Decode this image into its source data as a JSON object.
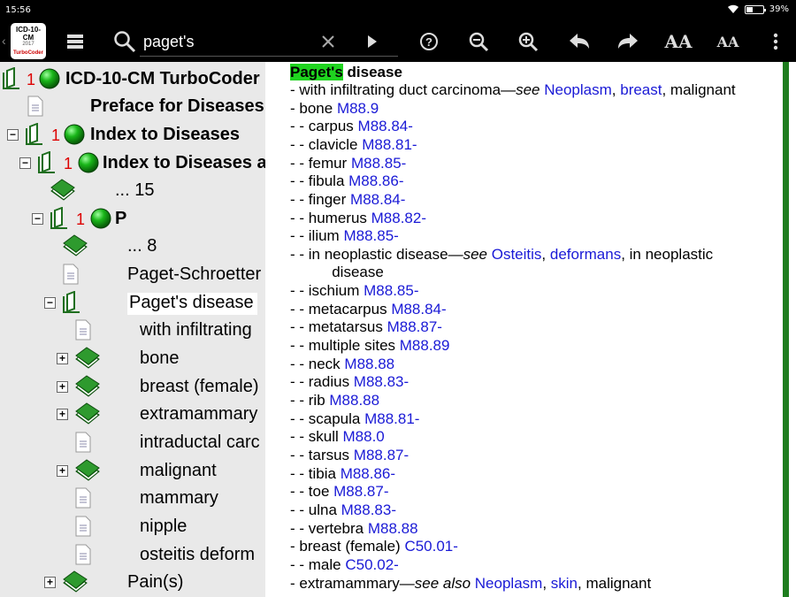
{
  "status": {
    "time": "15:56",
    "battery": "39%"
  },
  "toolbar": {
    "app_logo": {
      "line1": "ICD-10-CM",
      "line2": "2017",
      "line3": "TurboCoder"
    },
    "search_value": "paget's",
    "icons": [
      "menu-icon",
      "search-icon",
      "clear-icon",
      "go-icon",
      "help-icon",
      "zoom-out-icon",
      "zoom-in-icon",
      "back-icon",
      "forward-icon",
      "font-increase-icon",
      "font-decrease-icon",
      "overflow-icon"
    ],
    "font_increase_label": "AA",
    "font_decrease_label": "AA"
  },
  "tree": [
    {
      "label": "ICD-10-CM TurboCoder",
      "num": "1",
      "bold": true
    },
    {
      "label": "Preface for Diseases",
      "bold": true
    },
    {
      "label": "Index to Diseases",
      "num": "1",
      "bold": true,
      "toggle": "−"
    },
    {
      "label": "Index to Diseases a",
      "num": "1",
      "bold": true,
      "toggle": "−"
    },
    {
      "label": "... 15"
    },
    {
      "label": "P",
      "num": "1",
      "bold": true,
      "toggle": "−"
    },
    {
      "label": "... 8"
    },
    {
      "label": "Paget-Schroetter"
    },
    {
      "label": "Paget's disease",
      "toggle": "−",
      "selected": true
    },
    {
      "label": "with infiltrating"
    },
    {
      "label": "bone",
      "toggle": "+"
    },
    {
      "label": "breast (female)",
      "toggle": "+"
    },
    {
      "label": "extramammary",
      "toggle": "+"
    },
    {
      "label": "intraductal carc"
    },
    {
      "label": "malignant",
      "toggle": "+"
    },
    {
      "label": "mammary"
    },
    {
      "label": "nipple"
    },
    {
      "label": "osteitis deform"
    },
    {
      "label": "Pain(s)",
      "toggle": "+"
    }
  ],
  "entry": {
    "term": "Paget's",
    "term_rest": " disease",
    "lines": [
      {
        "prefix": "- with infiltrating duct carcinoma",
        "see": "see",
        "links": [
          "Neoplasm",
          "breast"
        ],
        "suffix": ", malignant"
      },
      {
        "prefix": "- bone ",
        "code": "M88.9"
      },
      {
        "prefix": "- - carpus ",
        "code": "M88.84-"
      },
      {
        "prefix": "- - clavicle ",
        "code": "M88.81-"
      },
      {
        "prefix": "- - femur ",
        "code": "M88.85-"
      },
      {
        "prefix": "- - fibula ",
        "code": "M88.86-"
      },
      {
        "prefix": "- - finger ",
        "code": "M88.84-"
      },
      {
        "prefix": "- - humerus ",
        "code": "M88.82-"
      },
      {
        "prefix": "- - ilium ",
        "code": "M88.85-"
      },
      {
        "prefix": "- - in neoplastic disease",
        "see": "see",
        "links": [
          "Osteitis",
          "deformans"
        ],
        "suffix": ", in neoplastic"
      },
      {
        "prefix": "          disease"
      },
      {
        "prefix": "- - ischium ",
        "code": "M88.85-"
      },
      {
        "prefix": "- - metacarpus ",
        "code": "M88.84-"
      },
      {
        "prefix": "- - metatarsus ",
        "code": "M88.87-"
      },
      {
        "prefix": "- - multiple sites ",
        "code": "M88.89"
      },
      {
        "prefix": "- - neck ",
        "code": "M88.88"
      },
      {
        "prefix": "- - radius ",
        "code": "M88.83-"
      },
      {
        "prefix": "- - rib ",
        "code": "M88.88"
      },
      {
        "prefix": "- - scapula ",
        "code": "M88.81-"
      },
      {
        "prefix": "- - skull ",
        "code": "M88.0"
      },
      {
        "prefix": "- - tarsus ",
        "code": "M88.87-"
      },
      {
        "prefix": "- - tibia ",
        "code": "M88.86-"
      },
      {
        "prefix": "- - toe ",
        "code": "M88.87-"
      },
      {
        "prefix": "- - ulna ",
        "code": "M88.83-"
      },
      {
        "prefix": "- - vertebra ",
        "code": "M88.88"
      },
      {
        "prefix": "- breast (female) ",
        "code": "C50.01-"
      },
      {
        "prefix": "- - male ",
        "code": "C50.02-"
      },
      {
        "prefix": "- extramammary",
        "see": "see also",
        "links": [
          "Neoplasm",
          "skin"
        ],
        "suffix": ", malignant"
      }
    ]
  },
  "colors": {
    "accent_green": "#1fd41f",
    "link_blue": "#1a1ad6",
    "tree_bg": "#e9e9e9",
    "count_red": "#d00000",
    "side_bar": "#1e7d1e"
  }
}
